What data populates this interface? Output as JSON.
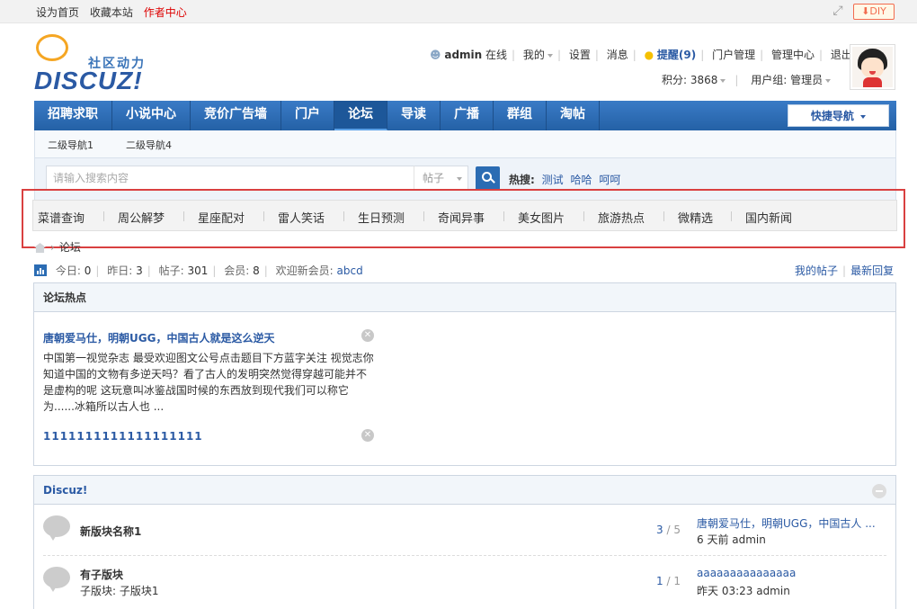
{
  "topbar": {
    "set_home": "设为首页",
    "bookmark": "收藏本站",
    "author_center": "作者中心",
    "diy": "DIY"
  },
  "logo": {
    "sub": "社区动力",
    "main": "DISCUZ!"
  },
  "user": {
    "name": "admin",
    "online": "在线",
    "mine": "我的",
    "settings": "设置",
    "messages": "消息",
    "remind": "提醒(9)",
    "portal_admin": "门户管理",
    "admin_center": "管理中心",
    "logout": "退出",
    "points": "积分: 3868",
    "group": "用户组: 管理员"
  },
  "nav": {
    "items": [
      "招聘求职",
      "小说中心",
      "竞价广告墙",
      "门户",
      "论坛",
      "导读",
      "广播",
      "群组",
      "淘帖"
    ],
    "active_index": 4,
    "quick": "快捷导航"
  },
  "subnav": [
    "二级导航1",
    "二级导航4"
  ],
  "search": {
    "placeholder": "请输入搜索内容",
    "type": "帖子",
    "hot_label": "热搜:",
    "hot": [
      "测试",
      "哈哈",
      "呵呵"
    ]
  },
  "categories": [
    "菜谱查询",
    "周公解梦",
    "星座配对",
    "雷人笑话",
    "生日预测",
    "奇闻异事",
    "美女图片",
    "旅游热点",
    "微精选",
    "国内新闻"
  ],
  "breadcrumb": {
    "current": "论坛"
  },
  "stats": {
    "today_label": "今日:",
    "today": "0",
    "yesterday_label": "昨日:",
    "yesterday": "3",
    "posts_label": "帖子:",
    "posts": "301",
    "members_label": "会员:",
    "members": "8",
    "newmember_label": "欢迎新会员:",
    "newmember": "abcd",
    "my_posts": "我的帖子",
    "latest": "最新回复"
  },
  "hot": {
    "title": "论坛热点",
    "thread1_title": "唐朝爱马仕，明朝UGG，中国古人就是这么逆天",
    "thread1_body": "中国第一视觉杂志 最受欢迎图文公号点击题目下方蓝字关注 视觉志你知道中国的文物有多逆天吗？看了古人的发明突然觉得穿越可能并不是虚构的呢 这玩意叫冰鉴战国时候的东西放到现代我们可以称它为......冰箱所以古人也 ...",
    "thread2_title": "1111111111111111111"
  },
  "forum": {
    "title": "Discuz!",
    "rows": [
      {
        "name": "新版块名称1",
        "sub": "",
        "count_a": "3",
        "count_b": "5",
        "last": "唐朝爱马仕，明朝UGG，中国古人 ...",
        "meta": "6 天前 admin"
      },
      {
        "name": "有子版块",
        "sub": "子版块: 子版块1",
        "count_a": "1",
        "count_b": "1",
        "last": "aaaaaaaaaaaaaaa",
        "meta": "昨天 03:23 admin"
      }
    ]
  }
}
